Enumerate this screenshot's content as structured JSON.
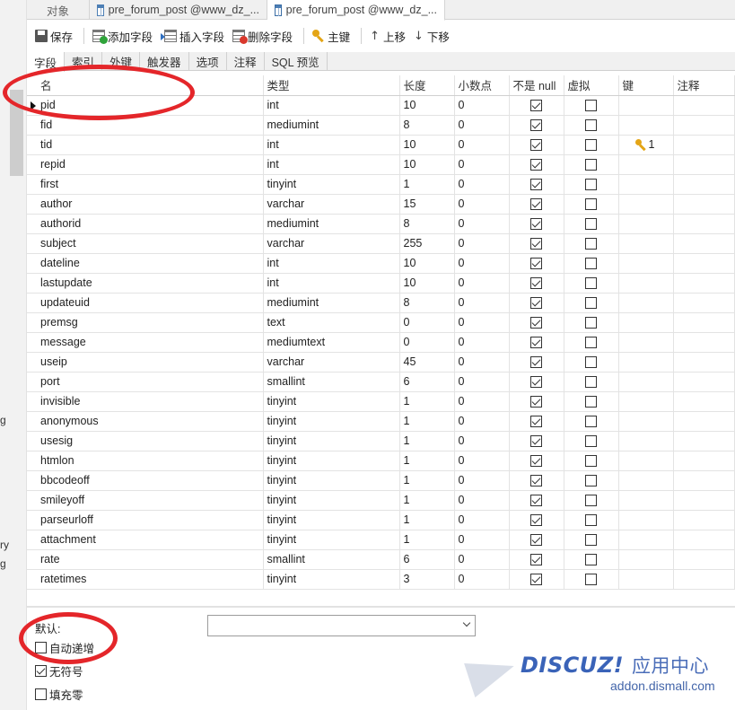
{
  "left_fragments": [
    "g",
    "ry",
    "g"
  ],
  "tabs": [
    {
      "label": "对象"
    },
    {
      "label": "pre_forum_post @www_dz_..."
    },
    {
      "label": "pre_forum_post @www_dz_..."
    }
  ],
  "toolbar": {
    "save": "保存",
    "add_field": "添加字段",
    "insert_field": "插入字段",
    "delete_field": "删除字段",
    "primary_key": "主键",
    "move_up": "上移",
    "move_down": "下移"
  },
  "subtabs": [
    "字段",
    "索引",
    "外键",
    "触发器",
    "选项",
    "注释",
    "SQL 预览"
  ],
  "columns": [
    "名",
    "类型",
    "长度",
    "小数点",
    "不是 null",
    "虚拟",
    "键",
    "注释"
  ],
  "rows": [
    {
      "name": "pid",
      "type": "int",
      "length": "10",
      "decimals": "0",
      "not_null": true,
      "virtual": false,
      "key": ""
    },
    {
      "name": "fid",
      "type": "mediumint",
      "length": "8",
      "decimals": "0",
      "not_null": true,
      "virtual": false,
      "key": ""
    },
    {
      "name": "tid",
      "type": "int",
      "length": "10",
      "decimals": "0",
      "not_null": true,
      "virtual": false,
      "key": "1"
    },
    {
      "name": "repid",
      "type": "int",
      "length": "10",
      "decimals": "0",
      "not_null": true,
      "virtual": false,
      "key": ""
    },
    {
      "name": "first",
      "type": "tinyint",
      "length": "1",
      "decimals": "0",
      "not_null": true,
      "virtual": false,
      "key": ""
    },
    {
      "name": "author",
      "type": "varchar",
      "length": "15",
      "decimals": "0",
      "not_null": true,
      "virtual": false,
      "key": ""
    },
    {
      "name": "authorid",
      "type": "mediumint",
      "length": "8",
      "decimals": "0",
      "not_null": true,
      "virtual": false,
      "key": ""
    },
    {
      "name": "subject",
      "type": "varchar",
      "length": "255",
      "decimals": "0",
      "not_null": true,
      "virtual": false,
      "key": ""
    },
    {
      "name": "dateline",
      "type": "int",
      "length": "10",
      "decimals": "0",
      "not_null": true,
      "virtual": false,
      "key": ""
    },
    {
      "name": "lastupdate",
      "type": "int",
      "length": "10",
      "decimals": "0",
      "not_null": true,
      "virtual": false,
      "key": ""
    },
    {
      "name": "updateuid",
      "type": "mediumint",
      "length": "8",
      "decimals": "0",
      "not_null": true,
      "virtual": false,
      "key": ""
    },
    {
      "name": "premsg",
      "type": "text",
      "length": "0",
      "decimals": "0",
      "not_null": true,
      "virtual": false,
      "key": ""
    },
    {
      "name": "message",
      "type": "mediumtext",
      "length": "0",
      "decimals": "0",
      "not_null": true,
      "virtual": false,
      "key": ""
    },
    {
      "name": "useip",
      "type": "varchar",
      "length": "45",
      "decimals": "0",
      "not_null": true,
      "virtual": false,
      "key": ""
    },
    {
      "name": "port",
      "type": "smallint",
      "length": "6",
      "decimals": "0",
      "not_null": true,
      "virtual": false,
      "key": ""
    },
    {
      "name": "invisible",
      "type": "tinyint",
      "length": "1",
      "decimals": "0",
      "not_null": true,
      "virtual": false,
      "key": ""
    },
    {
      "name": "anonymous",
      "type": "tinyint",
      "length": "1",
      "decimals": "0",
      "not_null": true,
      "virtual": false,
      "key": ""
    },
    {
      "name": "usesig",
      "type": "tinyint",
      "length": "1",
      "decimals": "0",
      "not_null": true,
      "virtual": false,
      "key": ""
    },
    {
      "name": "htmlon",
      "type": "tinyint",
      "length": "1",
      "decimals": "0",
      "not_null": true,
      "virtual": false,
      "key": ""
    },
    {
      "name": "bbcodeoff",
      "type": "tinyint",
      "length": "1",
      "decimals": "0",
      "not_null": true,
      "virtual": false,
      "key": ""
    },
    {
      "name": "smileyoff",
      "type": "tinyint",
      "length": "1",
      "decimals": "0",
      "not_null": true,
      "virtual": false,
      "key": ""
    },
    {
      "name": "parseurloff",
      "type": "tinyint",
      "length": "1",
      "decimals": "0",
      "not_null": true,
      "virtual": false,
      "key": ""
    },
    {
      "name": "attachment",
      "type": "tinyint",
      "length": "1",
      "decimals": "0",
      "not_null": true,
      "virtual": false,
      "key": ""
    },
    {
      "name": "rate",
      "type": "smallint",
      "length": "6",
      "decimals": "0",
      "not_null": true,
      "virtual": false,
      "key": ""
    },
    {
      "name": "ratetimes",
      "type": "tinyint",
      "length": "3",
      "decimals": "0",
      "not_null": true,
      "virtual": false,
      "key": ""
    }
  ],
  "bottom": {
    "default_label": "默认:",
    "default_value": "",
    "auto_increment": {
      "label": "自动递增",
      "checked": false
    },
    "unsigned": {
      "label": "无符号",
      "checked": true
    },
    "zerofill": {
      "label": "填充零",
      "checked": false
    }
  },
  "watermark": {
    "brand": "DISCUZ!",
    "brand_cn": "应用中心",
    "url": "addon.dismall.com"
  },
  "colors": {
    "annotation_red": "#e4262a",
    "watermark_blue": "#3a63b8",
    "key_gold": "#e4a516"
  }
}
